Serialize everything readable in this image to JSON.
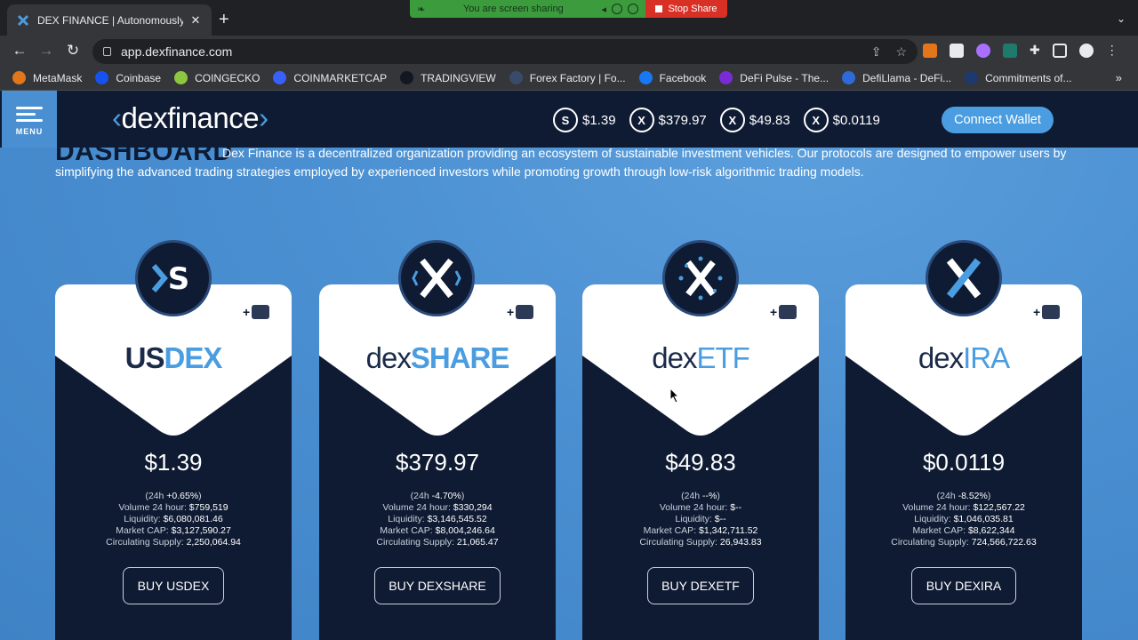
{
  "browser": {
    "tab_title": "DEX FINANCE | Autonomously",
    "tab_close": "✕",
    "new_tab": "+",
    "tabs_menu": "⌄",
    "url": "app.dexfinance.com",
    "nav": {
      "back": "←",
      "forward": "→",
      "reload": "↻"
    },
    "share_message": "You are screen sharing",
    "stop_share": "Stop Share",
    "bookmarks": [
      {
        "label": "MetaMask",
        "color": "#e2761b"
      },
      {
        "label": "Coinbase",
        "color": "#1652f0"
      },
      {
        "label": "COINGECKO",
        "color": "#8dc63f"
      },
      {
        "label": "COINMARKETCAP",
        "color": "#3861fb"
      },
      {
        "label": "TRADINGVIEW",
        "color": "#131722"
      },
      {
        "label": "Forex Factory | Fo...",
        "color": "#3a4a6a"
      },
      {
        "label": "Facebook",
        "color": "#1877f2"
      },
      {
        "label": "DeFi Pulse - The...",
        "color": "#7a2bd6"
      },
      {
        "label": "DefiLlama - DeFi...",
        "color": "#2f6bd8"
      },
      {
        "label": "Commitments of...",
        "color": "#1d3a6e"
      }
    ],
    "bookmarks_more": "»"
  },
  "header": {
    "menu_label": "MENU",
    "logo_text": "dexfinance",
    "logo_left": "‹",
    "logo_right": "›",
    "prices": [
      {
        "symbol": "S",
        "value": "$1.39"
      },
      {
        "symbol": "X",
        "value": "$379.97"
      },
      {
        "symbol": "X",
        "value": "$49.83"
      },
      {
        "symbol": "X",
        "value": "$0.0119"
      }
    ],
    "connect_wallet": "Connect Wallet"
  },
  "dashboard": {
    "title": "DASHBOARD",
    "intro": "Dex Finance is a decentralized organization providing an ecosystem of sustainable investment vehicles. Our protocols are designed to empower users by simplifying the advanced trading strategies employed by experienced investors while promoting growth through low-risk algorithmic trading models."
  },
  "cards": [
    {
      "brand_dark": "US",
      "brand_blue": "DEX",
      "add_label": "+",
      "coin_glyph": "S",
      "price": "$1.39",
      "change_prefix": "(24h ",
      "change": "+0.65%",
      "change_suffix": ")",
      "volume_label": "Volume 24 hour: ",
      "volume": "$759,519",
      "liquidity_label": "Liquidity: ",
      "liquidity": "$6,080,081.46",
      "mcap_label": "Market CAP: ",
      "mcap": "$3,127,590.27",
      "supply_label": "Circulating Supply: ",
      "supply": "2,250,064.94",
      "buy": "BUY USDEX"
    },
    {
      "brand_dark": "dex",
      "brand_blue": "SHARE",
      "add_label": "+",
      "coin_glyph": "X",
      "price": "$379.97",
      "change_prefix": "(24h ",
      "change": "-4.70%",
      "change_suffix": ")",
      "volume_label": "Volume 24 hour: ",
      "volume": "$330,294",
      "liquidity_label": "Liquidity: ",
      "liquidity": "$3,146,545.52",
      "mcap_label": "Market CAP: ",
      "mcap": "$8,004,246.64",
      "supply_label": "Circulating Supply: ",
      "supply": "21,065.47",
      "buy": "BUY DEXSHARE"
    },
    {
      "brand_dark": "dex",
      "brand_blue": "ETF",
      "add_label": "+",
      "coin_glyph": "X",
      "price": "$49.83",
      "change_prefix": "(24h ",
      "change": "--%",
      "change_suffix": ")",
      "volume_label": "Volume 24 hour: ",
      "volume": "$--",
      "liquidity_label": "Liquidity: ",
      "liquidity": "$--",
      "mcap_label": "Market CAP: ",
      "mcap": "$1,342,711.52",
      "supply_label": "Circulating Supply: ",
      "supply": "26,943.83",
      "buy": "BUY DEXETF"
    },
    {
      "brand_dark": "dex",
      "brand_blue": "IRA",
      "add_label": "+",
      "coin_glyph": "X",
      "price": "$0.0119",
      "change_prefix": "(24h ",
      "change": "-8.52%",
      "change_suffix": ")",
      "volume_label": "Volume 24 hour: ",
      "volume": "$122,567.22",
      "liquidity_label": "Liquidity: ",
      "liquidity": "$1,046,035.81",
      "mcap_label": "Market CAP: ",
      "mcap": "$8,622,344",
      "supply_label": "Circulating Supply: ",
      "supply": "724,566,722.63",
      "buy": "BUY DEXIRA"
    }
  ],
  "colors": {
    "navy": "#0f1b33",
    "accent": "#4a9de0",
    "page_bg": "#4a8fd1"
  }
}
